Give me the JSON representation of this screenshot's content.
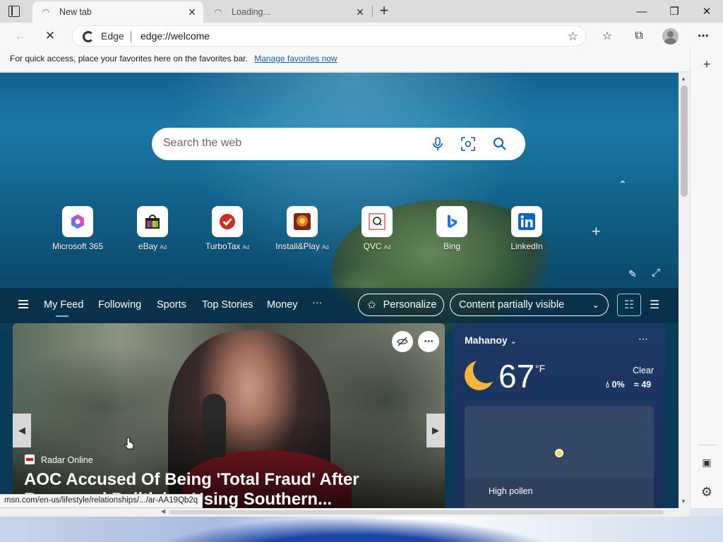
{
  "tabs": [
    {
      "title": "New tab",
      "active": true
    },
    {
      "title": "Loading...",
      "active": false
    }
  ],
  "address": {
    "site_label": "Edge",
    "url": "edge://welcome"
  },
  "favorites_bar": {
    "message": "For quick access, place your favorites here on the favorites bar.",
    "link": "Manage favorites now"
  },
  "search": {
    "placeholder": "Search the web"
  },
  "quick_links": [
    {
      "label": "Microsoft 365",
      "ad": ""
    },
    {
      "label": "eBay",
      "ad": "Ad"
    },
    {
      "label": "TurboTax",
      "ad": "Ad"
    },
    {
      "label": "Install&Play",
      "ad": "Ad"
    },
    {
      "label": "QVC",
      "ad": "Ad"
    },
    {
      "label": "Bing",
      "ad": ""
    },
    {
      "label": "LinkedIn",
      "ad": ""
    }
  ],
  "feed_nav": {
    "tabs": [
      "My Feed",
      "Following",
      "Sports",
      "Top Stories",
      "Money"
    ],
    "more": "···",
    "personalize": "Personalize",
    "content_visibility": "Content partially visible"
  },
  "hero": {
    "source": "Radar Online",
    "headline": "AOC Accused Of Being 'Total Fraud' After Remerged Politician Using Southern..."
  },
  "weather": {
    "location": "Mahanoy",
    "temperature": "67",
    "unit": "°F",
    "condition": "Clear",
    "precipitation": "0%",
    "wind": "49",
    "pollen": "High pollen"
  },
  "status_bar": {
    "url": "msn.com/en-us/lifestyle/relationships/.../ar-AA19Qb2q"
  },
  "colors": {
    "accent": "#0f5fb0",
    "tab_bar": "#dcdcdc",
    "toolbar": "#f7f7f7",
    "weather_bg": "#1d3a64"
  }
}
